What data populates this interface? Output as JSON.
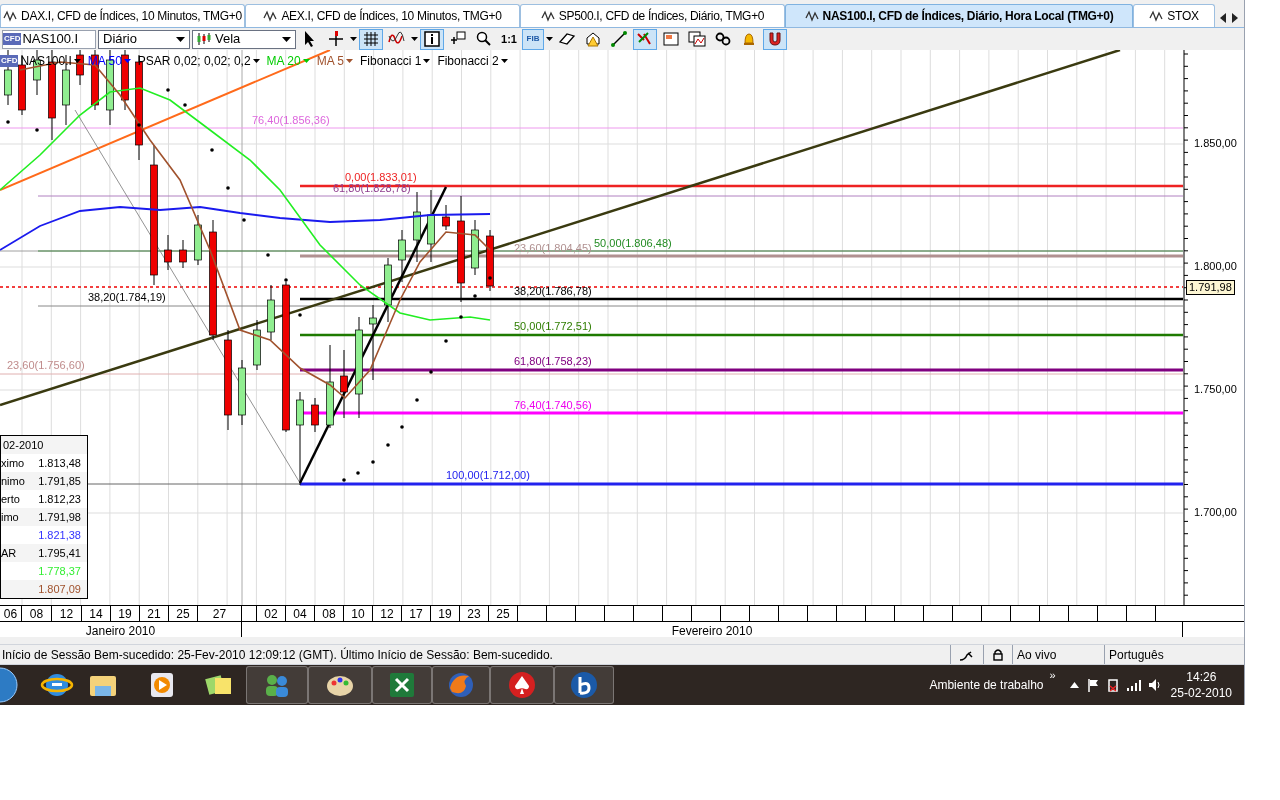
{
  "tabs": [
    {
      "label": "DAX.I, CFD de Índices, 10 Minutos, TMG+0",
      "selected": false
    },
    {
      "label": "AEX.I, CFD de Índices, 10 Minutos, TMG+0",
      "selected": false
    },
    {
      "label": "SP500.I, CFD de Índices, Diário, TMG+0",
      "selected": false
    },
    {
      "label": "NAS100.I, CFD de Índices, Diário, Hora Local (TMG+0)",
      "selected": true
    },
    {
      "label": "STOX",
      "selected": false
    }
  ],
  "toolbar": {
    "symbol": "NAS100.I",
    "symbol_badge": "CFD",
    "period": "Diário",
    "chart_type": "Vela",
    "tools": [
      {
        "kind": "pointer",
        "selected": false,
        "has_menu": false
      },
      {
        "kind": "crosshair",
        "selected": false,
        "has_menu": true
      },
      {
        "kind": "grid",
        "selected": true,
        "has_menu": false
      },
      {
        "kind": "indicators",
        "selected": false,
        "has_menu": true
      },
      {
        "kind": "info",
        "selected": true,
        "has_menu": false
      },
      {
        "kind": "new-window",
        "selected": false,
        "has_menu": false
      },
      {
        "kind": "zoom",
        "selected": false,
        "has_menu": false
      },
      {
        "kind": "text",
        "label": "1:1",
        "selected": false,
        "has_menu": false
      },
      {
        "kind": "badge",
        "label": "FIB",
        "selected": true,
        "has_menu": true
      },
      {
        "kind": "eraser",
        "selected": false,
        "has_menu": false
      },
      {
        "kind": "alert",
        "selected": false,
        "has_menu": false
      },
      {
        "kind": "line",
        "selected": false,
        "has_menu": false
      },
      {
        "kind": "drawings",
        "selected": true,
        "has_menu": false
      },
      {
        "kind": "save",
        "selected": false,
        "has_menu": false
      },
      {
        "kind": "compare",
        "selected": false,
        "has_menu": false
      },
      {
        "kind": "link",
        "selected": false,
        "has_menu": false
      },
      {
        "kind": "bell",
        "selected": false,
        "has_menu": false
      },
      {
        "kind": "magnet",
        "selected": true,
        "has_menu": false
      }
    ]
  },
  "legend": [
    {
      "label": "NAS100.I",
      "color": "#000000",
      "kind": "symbol",
      "badge": "CFD"
    },
    {
      "label": "MA 50",
      "color": "#0000ff",
      "kind": "indicator"
    },
    {
      "label": "PSAR 0,02; 0,02; 0,2",
      "color": "#000000",
      "kind": "indicator"
    },
    {
      "label": "MA 20",
      "color": "#00cc00",
      "kind": "indicator"
    },
    {
      "label": "MA 5",
      "color": "#a0522d",
      "kind": "indicator"
    },
    {
      "label": "Fibonacci 1",
      "color": "#000000",
      "kind": "indicator"
    },
    {
      "label": "Fibonacci 2",
      "color": "#000000",
      "kind": "indicator"
    }
  ],
  "chart": {
    "fib_labels": [
      {
        "text": "76,40(1.856,36)",
        "color": "#dd66dd"
      },
      {
        "text": "0,00(1.833,01)",
        "color": "#ee2222"
      },
      {
        "text": "61,80(1.828,78)",
        "color": "#904090"
      },
      {
        "text": "23,60(1.804,45)",
        "color": "#b09090"
      },
      {
        "text": "50,00(1.806,48)",
        "color": "#228b22"
      },
      {
        "text": "38,20(1.784,19)",
        "color": "#000000"
      },
      {
        "text": "38,20(1.786,78)",
        "color": "#000000"
      },
      {
        "text": "50,00(1.772,51)",
        "color": "#2e7d00"
      },
      {
        "text": "23,60(1.756,60)",
        "color": "#c08c8c"
      },
      {
        "text": "61,80(1.758,23)",
        "color": "#800080"
      },
      {
        "text": "76,40(1.740,56)",
        "color": "#ee00ee"
      },
      {
        "text": "100,00(1.712,00)",
        "color": "#2222ee"
      }
    ],
    "price_ticks": [
      "1.850,00",
      "1.800,00",
      "1.750,00",
      "1.700,00"
    ],
    "last_price": "1.791,98",
    "info_panel": {
      "date": "02-2010",
      "rows": [
        {
          "label": "ximo",
          "value": "1.813,48",
          "color": "#000000"
        },
        {
          "label": "nimo",
          "value": "1.791,85",
          "color": "#000000"
        },
        {
          "label": "erto",
          "value": "1.812,23",
          "color": "#000000"
        },
        {
          "label": "imo",
          "value": "1.791,98",
          "color": "#000000"
        },
        {
          "value": "1.821,38",
          "color": "#3333ff"
        },
        {
          "label": "AR",
          "value": "1.795,41",
          "color": "#000000"
        },
        {
          "value": "1.778,37",
          "color": "#33ee33"
        },
        {
          "value": "1.807,09",
          "color": "#a0522d"
        }
      ]
    },
    "dates": [
      "06",
      "08",
      "12",
      "14",
      "19",
      "21",
      "25",
      "27",
      "02",
      "04",
      "08",
      "10",
      "12",
      "17",
      "19",
      "23",
      "25"
    ],
    "months": [
      "Janeiro 2010",
      "Fevereiro 2010"
    ]
  },
  "status_bar": {
    "message": "Início de Sessão Bem-sucedido: 25-Fev-2010 12:09:12 (GMT). Último Início de Sessão: Bem-sucedido.",
    "connection": "Ao vivo",
    "language": "Português"
  },
  "taskbar": {
    "desktop_label": "Ambiente de trabalho",
    "overflow": "»",
    "time": "14:26",
    "date": "25-02-2010"
  }
}
